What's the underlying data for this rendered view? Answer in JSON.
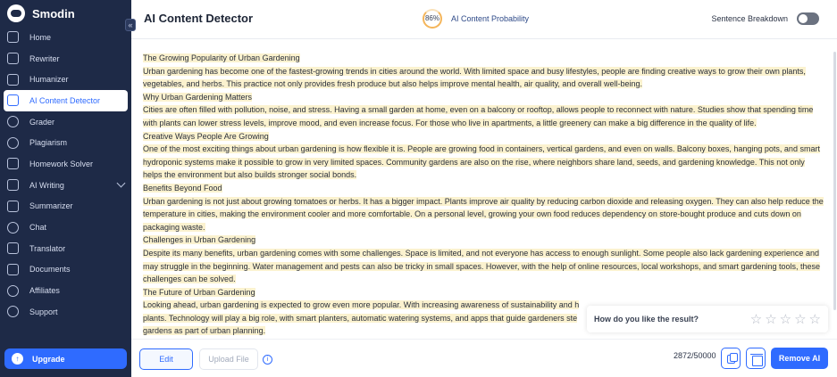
{
  "app": {
    "brand": "Smodin"
  },
  "sidebar": {
    "items": [
      {
        "label": "Home",
        "icon": "home-icon"
      },
      {
        "label": "Rewriter",
        "icon": "rewriter-icon"
      },
      {
        "label": "Humanizer",
        "icon": "humanizer-icon"
      },
      {
        "label": "AI Content Detector",
        "icon": "detector-icon",
        "active": true
      },
      {
        "label": "Grader",
        "icon": "grader-icon"
      },
      {
        "label": "Plagiarism",
        "icon": "plagiarism-icon"
      },
      {
        "label": "Homework Solver",
        "icon": "homework-icon"
      },
      {
        "label": "AI Writing",
        "icon": "writing-icon",
        "expandable": true
      },
      {
        "label": "Summarizer",
        "icon": "summarizer-icon"
      },
      {
        "label": "Chat",
        "icon": "chat-icon"
      },
      {
        "label": "Translator",
        "icon": "translator-icon"
      },
      {
        "label": "Documents",
        "icon": "documents-icon"
      },
      {
        "label": "Affiliates",
        "icon": "affiliates-icon"
      },
      {
        "label": "Support",
        "icon": "support-icon"
      }
    ],
    "upgrade_label": "Upgrade"
  },
  "header": {
    "title": "AI Content Detector",
    "probability_value": "86%",
    "probability_label": "AI Content Probability",
    "breakdown_label": "Sentence Breakdown"
  },
  "content": [
    {
      "text": "The Growing Popularity of Urban Gardening"
    },
    {
      "text": "Urban gardening has become one of the fastest-growing trends in cities around the world.  With limited space and busy lifestyles, people are finding creative ways to grow their own plants, vegetables, and herbs.  This practice not only provides fresh produce but also helps improve mental health, air quality, and overall well-being."
    },
    {
      "text": "Why Urban Gardening Matters"
    },
    {
      "text": "Cities are often filled with pollution, noise, and stress.  Having a small garden at home, even on a balcony or rooftop, allows people to reconnect with nature.  Studies show that spending time with plants can lower stress levels, improve mood, and even increase focus.  For those who live in apartments, a little greenery can make a big difference in the quality of life."
    },
    {
      "text": "Creative Ways People Are Growing"
    },
    {
      "text": "One of the most exciting things about urban gardening is how flexible it is.  People are growing food in containers, vertical gardens, and even on walls.  Balcony boxes, hanging pots, and smart hydroponic systems make it possible to grow in very limited spaces.  Community gardens are also on the rise, where neighbors share land, seeds, and gardening knowledge.  This not only helps the environment but also builds stronger social bonds."
    },
    {
      "text": "Benefits Beyond Food"
    },
    {
      "text": "Urban gardening is not just about growing tomatoes or herbs.  It has a bigger impact.  Plants improve air quality by reducing carbon dioxide and releasing oxygen.  They can also help reduce the temperature in cities, making the environment cooler and more comfortable.  On a personal level, growing your own food reduces dependency on store-bought produce and cuts down on packaging waste."
    },
    {
      "text": "Challenges in Urban Gardening"
    },
    {
      "text": "Despite its many benefits, urban gardening comes with some challenges.  Space is limited, and not everyone has access to enough sunlight.  Some people also lack gardening experience and may struggle in the beginning.  Water management and pests can also be tricky in small spaces.  However, with the help of online resources, local workshops, and smart gardening tools, these challenges can be solved."
    },
    {
      "text": "The Future of Urban Gardening"
    },
    {
      "text": "Looking ahead, urban gardening is expected to grow even more popular.  With increasing awareness of sustainability and h"
    },
    {
      "text": "plants.  Technology will play a big role, with smart planters, automatic watering systems, and apps that guide gardeners ste"
    },
    {
      "text": "gardens as part of urban planning."
    }
  ],
  "feedback": {
    "question": "How do you like the result?",
    "stars": 5
  },
  "footer": {
    "edit_label": "Edit",
    "upload_label": "Upload File",
    "counter": "2872/50000",
    "remove_label": "Remove AI"
  },
  "colors": {
    "accent": "#2f6bff",
    "sidebar_bg": "#1e2a47",
    "highlight": "#fbf2cf"
  }
}
